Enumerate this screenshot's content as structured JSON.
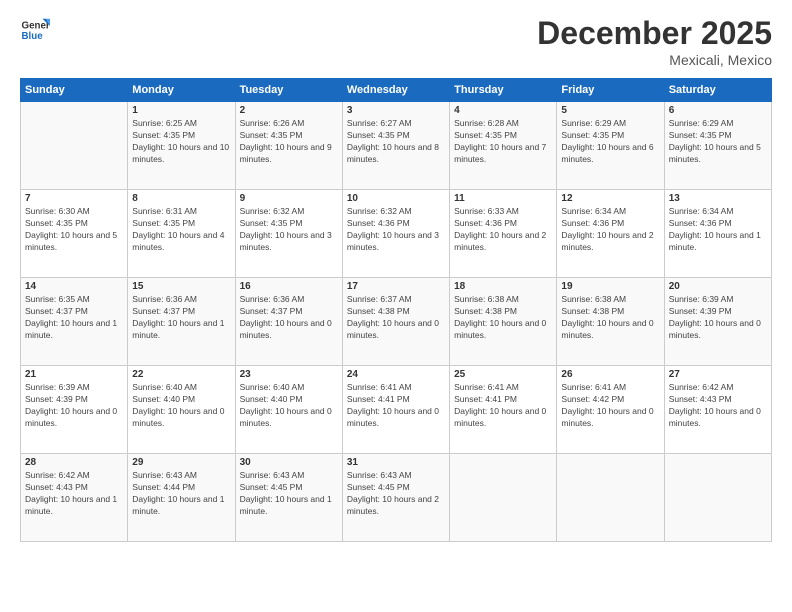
{
  "logo": {
    "text_general": "General",
    "text_blue": "Blue"
  },
  "header": {
    "month": "December 2025",
    "location": "Mexicali, Mexico"
  },
  "days_of_week": [
    "Sunday",
    "Monday",
    "Tuesday",
    "Wednesday",
    "Thursday",
    "Friday",
    "Saturday"
  ],
  "weeks": [
    [
      {
        "day": "",
        "sunrise": "",
        "sunset": "",
        "daylight": ""
      },
      {
        "day": "1",
        "sunrise": "Sunrise: 6:25 AM",
        "sunset": "Sunset: 4:35 PM",
        "daylight": "Daylight: 10 hours and 10 minutes."
      },
      {
        "day": "2",
        "sunrise": "Sunrise: 6:26 AM",
        "sunset": "Sunset: 4:35 PM",
        "daylight": "Daylight: 10 hours and 9 minutes."
      },
      {
        "day": "3",
        "sunrise": "Sunrise: 6:27 AM",
        "sunset": "Sunset: 4:35 PM",
        "daylight": "Daylight: 10 hours and 8 minutes."
      },
      {
        "day": "4",
        "sunrise": "Sunrise: 6:28 AM",
        "sunset": "Sunset: 4:35 PM",
        "daylight": "Daylight: 10 hours and 7 minutes."
      },
      {
        "day": "5",
        "sunrise": "Sunrise: 6:29 AM",
        "sunset": "Sunset: 4:35 PM",
        "daylight": "Daylight: 10 hours and 6 minutes."
      },
      {
        "day": "6",
        "sunrise": "Sunrise: 6:29 AM",
        "sunset": "Sunset: 4:35 PM",
        "daylight": "Daylight: 10 hours and 5 minutes."
      }
    ],
    [
      {
        "day": "7",
        "sunrise": "Sunrise: 6:30 AM",
        "sunset": "Sunset: 4:35 PM",
        "daylight": "Daylight: 10 hours and 5 minutes."
      },
      {
        "day": "8",
        "sunrise": "Sunrise: 6:31 AM",
        "sunset": "Sunset: 4:35 PM",
        "daylight": "Daylight: 10 hours and 4 minutes."
      },
      {
        "day": "9",
        "sunrise": "Sunrise: 6:32 AM",
        "sunset": "Sunset: 4:35 PM",
        "daylight": "Daylight: 10 hours and 3 minutes."
      },
      {
        "day": "10",
        "sunrise": "Sunrise: 6:32 AM",
        "sunset": "Sunset: 4:36 PM",
        "daylight": "Daylight: 10 hours and 3 minutes."
      },
      {
        "day": "11",
        "sunrise": "Sunrise: 6:33 AM",
        "sunset": "Sunset: 4:36 PM",
        "daylight": "Daylight: 10 hours and 2 minutes."
      },
      {
        "day": "12",
        "sunrise": "Sunrise: 6:34 AM",
        "sunset": "Sunset: 4:36 PM",
        "daylight": "Daylight: 10 hours and 2 minutes."
      },
      {
        "day": "13",
        "sunrise": "Sunrise: 6:34 AM",
        "sunset": "Sunset: 4:36 PM",
        "daylight": "Daylight: 10 hours and 1 minute."
      }
    ],
    [
      {
        "day": "14",
        "sunrise": "Sunrise: 6:35 AM",
        "sunset": "Sunset: 4:37 PM",
        "daylight": "Daylight: 10 hours and 1 minute."
      },
      {
        "day": "15",
        "sunrise": "Sunrise: 6:36 AM",
        "sunset": "Sunset: 4:37 PM",
        "daylight": "Daylight: 10 hours and 1 minute."
      },
      {
        "day": "16",
        "sunrise": "Sunrise: 6:36 AM",
        "sunset": "Sunset: 4:37 PM",
        "daylight": "Daylight: 10 hours and 0 minutes."
      },
      {
        "day": "17",
        "sunrise": "Sunrise: 6:37 AM",
        "sunset": "Sunset: 4:38 PM",
        "daylight": "Daylight: 10 hours and 0 minutes."
      },
      {
        "day": "18",
        "sunrise": "Sunrise: 6:38 AM",
        "sunset": "Sunset: 4:38 PM",
        "daylight": "Daylight: 10 hours and 0 minutes."
      },
      {
        "day": "19",
        "sunrise": "Sunrise: 6:38 AM",
        "sunset": "Sunset: 4:38 PM",
        "daylight": "Daylight: 10 hours and 0 minutes."
      },
      {
        "day": "20",
        "sunrise": "Sunrise: 6:39 AM",
        "sunset": "Sunset: 4:39 PM",
        "daylight": "Daylight: 10 hours and 0 minutes."
      }
    ],
    [
      {
        "day": "21",
        "sunrise": "Sunrise: 6:39 AM",
        "sunset": "Sunset: 4:39 PM",
        "daylight": "Daylight: 10 hours and 0 minutes."
      },
      {
        "day": "22",
        "sunrise": "Sunrise: 6:40 AM",
        "sunset": "Sunset: 4:40 PM",
        "daylight": "Daylight: 10 hours and 0 minutes."
      },
      {
        "day": "23",
        "sunrise": "Sunrise: 6:40 AM",
        "sunset": "Sunset: 4:40 PM",
        "daylight": "Daylight: 10 hours and 0 minutes."
      },
      {
        "day": "24",
        "sunrise": "Sunrise: 6:41 AM",
        "sunset": "Sunset: 4:41 PM",
        "daylight": "Daylight: 10 hours and 0 minutes."
      },
      {
        "day": "25",
        "sunrise": "Sunrise: 6:41 AM",
        "sunset": "Sunset: 4:41 PM",
        "daylight": "Daylight: 10 hours and 0 minutes."
      },
      {
        "day": "26",
        "sunrise": "Sunrise: 6:41 AM",
        "sunset": "Sunset: 4:42 PM",
        "daylight": "Daylight: 10 hours and 0 minutes."
      },
      {
        "day": "27",
        "sunrise": "Sunrise: 6:42 AM",
        "sunset": "Sunset: 4:43 PM",
        "daylight": "Daylight: 10 hours and 0 minutes."
      }
    ],
    [
      {
        "day": "28",
        "sunrise": "Sunrise: 6:42 AM",
        "sunset": "Sunset: 4:43 PM",
        "daylight": "Daylight: 10 hours and 1 minute."
      },
      {
        "day": "29",
        "sunrise": "Sunrise: 6:43 AM",
        "sunset": "Sunset: 4:44 PM",
        "daylight": "Daylight: 10 hours and 1 minute."
      },
      {
        "day": "30",
        "sunrise": "Sunrise: 6:43 AM",
        "sunset": "Sunset: 4:45 PM",
        "daylight": "Daylight: 10 hours and 1 minute."
      },
      {
        "day": "31",
        "sunrise": "Sunrise: 6:43 AM",
        "sunset": "Sunset: 4:45 PM",
        "daylight": "Daylight: 10 hours and 2 minutes."
      },
      {
        "day": "",
        "sunrise": "",
        "sunset": "",
        "daylight": ""
      },
      {
        "day": "",
        "sunrise": "",
        "sunset": "",
        "daylight": ""
      },
      {
        "day": "",
        "sunrise": "",
        "sunset": "",
        "daylight": ""
      }
    ]
  ]
}
